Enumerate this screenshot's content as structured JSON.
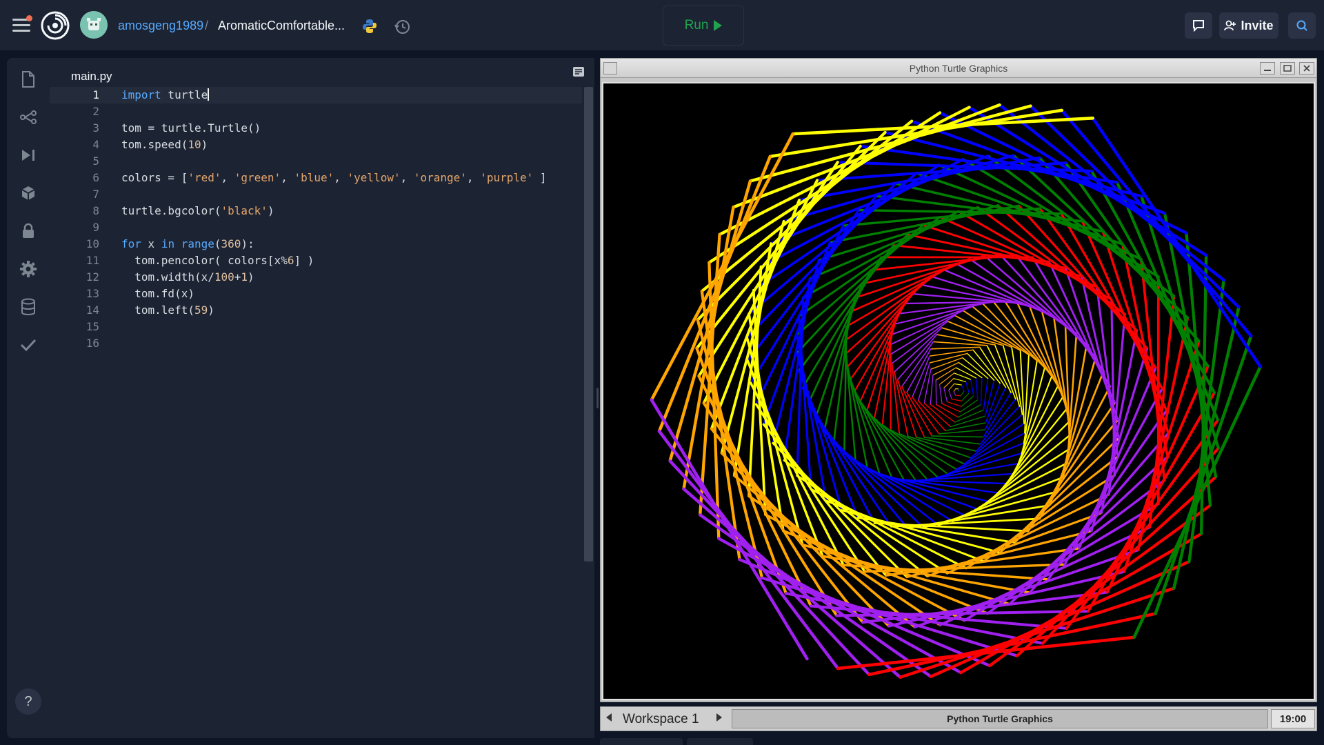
{
  "topbar": {
    "owner": "amosgeng1989",
    "separator": "/",
    "repl_name": "AromaticComfortable...",
    "run_label": "Run",
    "invite_label": "Invite"
  },
  "sidebar": {
    "items": [
      {
        "icon": "files-icon"
      },
      {
        "icon": "version-control-icon"
      },
      {
        "icon": "debugger-icon"
      },
      {
        "icon": "packages-icon"
      },
      {
        "icon": "secrets-lock-icon"
      },
      {
        "icon": "settings-gear-icon"
      },
      {
        "icon": "database-icon"
      },
      {
        "icon": "unit-tests-check-icon"
      }
    ],
    "help_label": "?"
  },
  "editor": {
    "tab_label": "main.py",
    "line_numbers": [
      "1",
      "2",
      "3",
      "4",
      "5",
      "6",
      "7",
      "8",
      "9",
      "10",
      "11",
      "12",
      "13",
      "14",
      "15",
      "16"
    ]
  },
  "turtle_window": {
    "title": "Python Turtle Graphics",
    "colors": [
      "red",
      "green",
      "blue",
      "yellow",
      "orange",
      "purple"
    ],
    "color_hex": {
      "red": "#ff0000",
      "green": "#008000",
      "blue": "#0000ff",
      "yellow": "#ffff00",
      "orange": "#ffa500",
      "purple": "#a020f0"
    }
  },
  "taskbar": {
    "workspace": "Workspace 1",
    "task": "Python Turtle Graphics",
    "clock": "19:00"
  },
  "theme": {
    "bg": "#0e1525",
    "panel": "#1c2333",
    "accent": "#57abff",
    "run_green": "#20a34d"
  }
}
